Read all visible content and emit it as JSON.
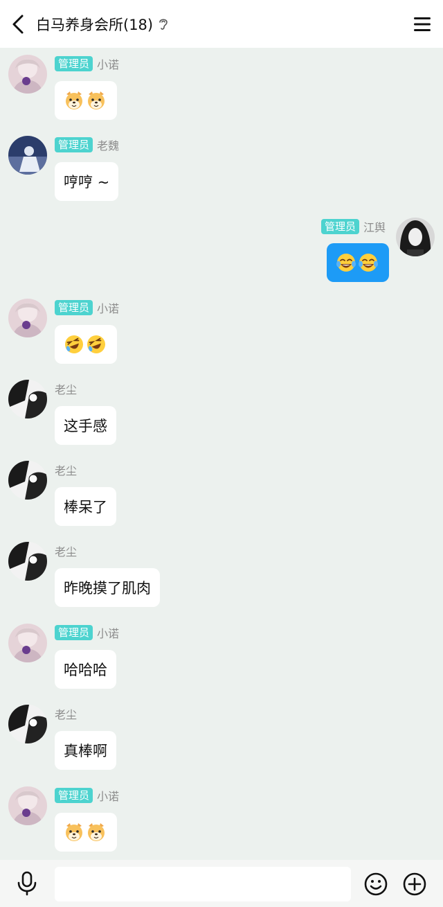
{
  "header": {
    "title": "白马养身会所(18)",
    "back_icon": "chevron-left-icon",
    "ear_icon": "ear-icon",
    "menu_icon": "menu-icon"
  },
  "badge_label": "管理员",
  "colors": {
    "background": "#ecf1ee",
    "badge": "#4dd3cf",
    "own_bubble": "#1d9bf6",
    "bubble": "#ffffff"
  },
  "messages": [
    {
      "sender": "小诺",
      "admin": true,
      "side": "left",
      "content": "",
      "emoji": [
        "dog-emoji",
        "dog-emoji"
      ]
    },
    {
      "sender": "老魏",
      "admin": true,
      "side": "left",
      "content": "哼哼 ~"
    },
    {
      "sender": "江舆",
      "admin": true,
      "side": "right",
      "content": "",
      "emoji": [
        "tears-of-joy-emoji",
        "tears-of-joy-emoji"
      ]
    },
    {
      "sender": "小诺",
      "admin": true,
      "side": "left",
      "content": "",
      "emoji": [
        "laughing-tears-emoji",
        "laughing-tears-emoji"
      ]
    },
    {
      "sender": "老尘",
      "admin": false,
      "side": "left",
      "content": "这手感"
    },
    {
      "sender": "老尘",
      "admin": false,
      "side": "left",
      "content": "棒呆了"
    },
    {
      "sender": "老尘",
      "admin": false,
      "side": "left",
      "content": "昨晚摸了肌肉"
    },
    {
      "sender": "小诺",
      "admin": true,
      "side": "left",
      "content": "哈哈哈"
    },
    {
      "sender": "老尘",
      "admin": false,
      "side": "left",
      "content": "真棒啊"
    },
    {
      "sender": "小诺",
      "admin": true,
      "side": "left",
      "content": "",
      "emoji": [
        "dog-emoji",
        "dog-emoji"
      ]
    }
  ],
  "input": {
    "placeholder": "",
    "value": ""
  },
  "toolbar": {
    "mic_icon": "microphone-icon",
    "emoji_icon": "smiley-icon",
    "plus_icon": "plus-icon"
  }
}
